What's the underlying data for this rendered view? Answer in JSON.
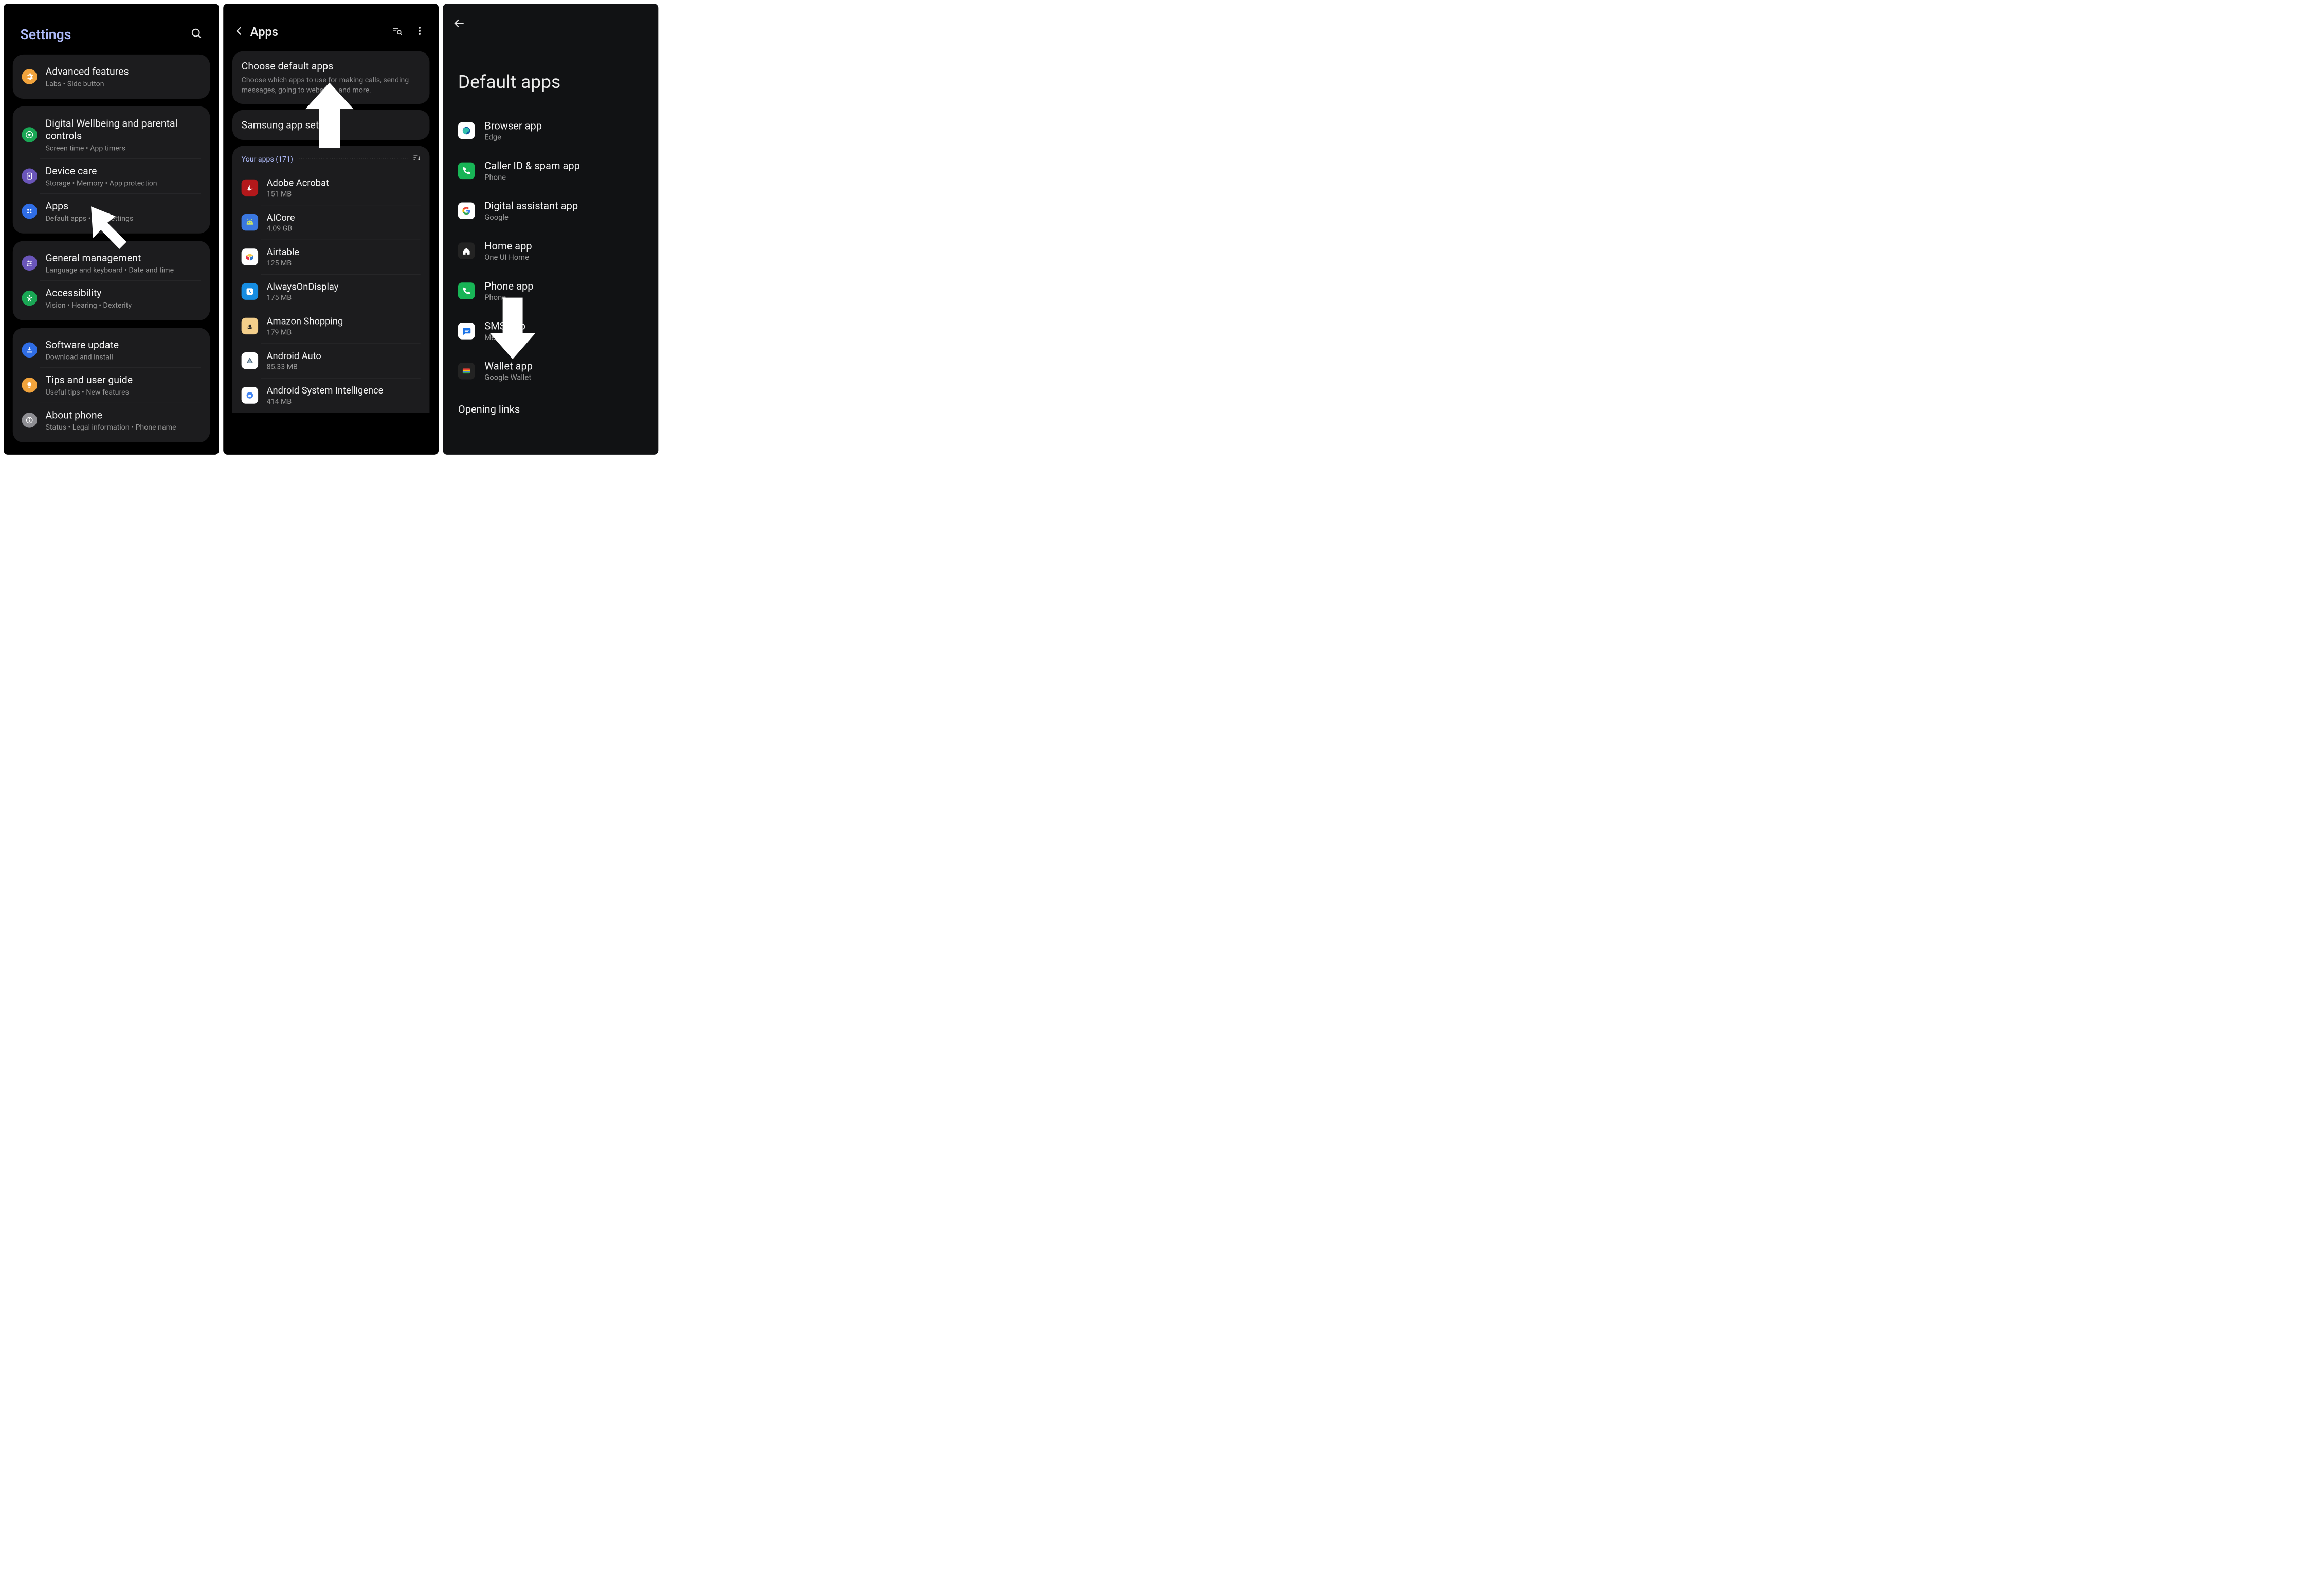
{
  "screen1": {
    "title": "Settings",
    "groups": [
      [
        {
          "icon": "gear",
          "color": "#f1a33c",
          "label": "Advanced features",
          "sub": "Labs  •  Side button"
        }
      ],
      [
        {
          "icon": "heart-circle",
          "color": "#1aa755",
          "label": "Digital Wellbeing and parental controls",
          "sub": "Screen time  •  App timers"
        },
        {
          "icon": "device-care",
          "color": "#6a55b9",
          "label": "Device care",
          "sub": "Storage  •  Memory  •  App protection"
        },
        {
          "icon": "apps-grid",
          "color": "#2f6de5",
          "label": "Apps",
          "sub": "Default apps  •  App settings"
        }
      ],
      [
        {
          "icon": "sliders",
          "color": "#6a55b9",
          "label": "General management",
          "sub": "Language and keyboard  •  Date and time"
        },
        {
          "icon": "accessibility",
          "color": "#1aa755",
          "label": "Accessibility",
          "sub": "Vision  •  Hearing  •  Dexterity"
        }
      ],
      [
        {
          "icon": "download",
          "color": "#2f6de5",
          "label": "Software update",
          "sub": "Download and install"
        },
        {
          "icon": "bulb",
          "color": "#f1a33c",
          "label": "Tips and user guide",
          "sub": "Useful tips  •  New features"
        },
        {
          "icon": "info",
          "color": "#8e8e93",
          "label": "About phone",
          "sub": "Status  •  Legal information  •  Phone name"
        }
      ]
    ]
  },
  "screen2": {
    "title": "Apps",
    "choose": {
      "title": "Choose default apps",
      "sub": "Choose which apps to use for making calls, sending messages, going to websites, and more."
    },
    "samsung": "Samsung app settings",
    "your_apps_label": "Your apps (171)",
    "apps": [
      {
        "name": "Adobe Acrobat",
        "size": "151 MB",
        "iconBg": "#b3181b",
        "glyph": "acrobat"
      },
      {
        "name": "AICore",
        "size": "4.09 GB",
        "iconBg": "#3a77e0",
        "glyph": "android-head"
      },
      {
        "name": "Airtable",
        "size": "125 MB",
        "iconBg": "#ffffff",
        "glyph": "airtable"
      },
      {
        "name": "AlwaysOnDisplay",
        "size": "175 MB",
        "iconBg": "#168de2",
        "glyph": "clock-square"
      },
      {
        "name": "Amazon Shopping",
        "size": "179 MB",
        "iconBg": "#f4cf8b",
        "glyph": "amazon"
      },
      {
        "name": "Android Auto",
        "size": "85.33 MB",
        "iconBg": "#ffffff",
        "glyph": "auto"
      },
      {
        "name": "Android System Intelligence",
        "size": "414 MB",
        "iconBg": "#ffffff",
        "glyph": "android-sys"
      }
    ]
  },
  "screen3": {
    "title": "Default apps",
    "items": [
      {
        "label": "Browser app",
        "sub": "Edge",
        "iconBg": "#ffffff",
        "glyph": "edge"
      },
      {
        "label": "Caller ID & spam app",
        "sub": "Phone",
        "iconBg": "#18b556",
        "glyph": "phone"
      },
      {
        "label": "Digital assistant app",
        "sub": "Google",
        "iconBg": "#ffffff",
        "glyph": "google-g"
      },
      {
        "label": "Home app",
        "sub": "One UI Home",
        "iconBg": "#232323",
        "glyph": "home"
      },
      {
        "label": "Phone app",
        "sub": "Phone",
        "iconBg": "#18b556",
        "glyph": "phone"
      },
      {
        "label": "SMS app",
        "sub": "Messages",
        "iconBg": "#ffffff",
        "glyph": "messages"
      },
      {
        "label": "Wallet app",
        "sub": "Google Wallet",
        "iconBg": "#232323",
        "glyph": "wallet"
      }
    ],
    "opening_links": "Opening links"
  }
}
